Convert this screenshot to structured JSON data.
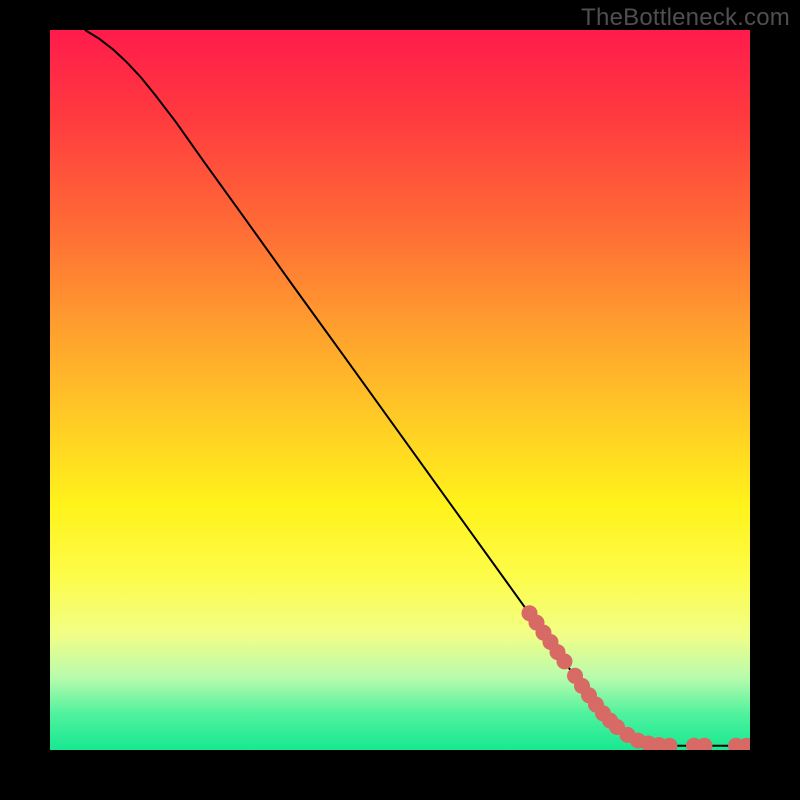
{
  "watermark": "TheBottleneck.com",
  "chart_data": {
    "type": "line",
    "title": "",
    "xlabel": "",
    "ylabel": "",
    "xlim": [
      0,
      100
    ],
    "ylim": [
      0,
      100
    ],
    "curve": [
      {
        "x": 5.0,
        "y": 100.0
      },
      {
        "x": 7.0,
        "y": 98.8
      },
      {
        "x": 9.0,
        "y": 97.3
      },
      {
        "x": 11.0,
        "y": 95.5
      },
      {
        "x": 13.0,
        "y": 93.4
      },
      {
        "x": 15.0,
        "y": 91.0
      },
      {
        "x": 18.0,
        "y": 87.2
      },
      {
        "x": 22.0,
        "y": 81.7
      },
      {
        "x": 28.0,
        "y": 73.6
      },
      {
        "x": 35.0,
        "y": 64.1
      },
      {
        "x": 42.0,
        "y": 54.7
      },
      {
        "x": 50.0,
        "y": 43.9
      },
      {
        "x": 58.0,
        "y": 33.1
      },
      {
        "x": 66.0,
        "y": 22.3
      },
      {
        "x": 72.0,
        "y": 14.2
      },
      {
        "x": 78.0,
        "y": 6.3
      },
      {
        "x": 82.0,
        "y": 2.5
      },
      {
        "x": 85.0,
        "y": 1.0
      },
      {
        "x": 88.0,
        "y": 0.6
      },
      {
        "x": 92.0,
        "y": 0.6
      },
      {
        "x": 96.0,
        "y": 0.6
      },
      {
        "x": 100.0,
        "y": 0.6
      }
    ],
    "series": [
      {
        "name": "markers",
        "points": [
          {
            "x": 68.5,
            "y": 19.0
          },
          {
            "x": 69.5,
            "y": 17.7
          },
          {
            "x": 70.5,
            "y": 16.3
          },
          {
            "x": 71.5,
            "y": 15.0
          },
          {
            "x": 72.5,
            "y": 13.6
          },
          {
            "x": 73.5,
            "y": 12.3
          },
          {
            "x": 75.0,
            "y": 10.3
          },
          {
            "x": 76.0,
            "y": 8.9
          },
          {
            "x": 77.0,
            "y": 7.6
          },
          {
            "x": 78.0,
            "y": 6.3
          },
          {
            "x": 79.0,
            "y": 5.1
          },
          {
            "x": 80.0,
            "y": 4.1
          },
          {
            "x": 81.0,
            "y": 3.2
          },
          {
            "x": 82.5,
            "y": 2.1
          },
          {
            "x": 84.0,
            "y": 1.3
          },
          {
            "x": 85.5,
            "y": 0.9
          },
          {
            "x": 87.0,
            "y": 0.7
          },
          {
            "x": 88.5,
            "y": 0.6
          },
          {
            "x": 92.0,
            "y": 0.6
          },
          {
            "x": 93.5,
            "y": 0.6
          },
          {
            "x": 98.0,
            "y": 0.6
          },
          {
            "x": 99.5,
            "y": 0.6
          }
        ]
      }
    ]
  }
}
